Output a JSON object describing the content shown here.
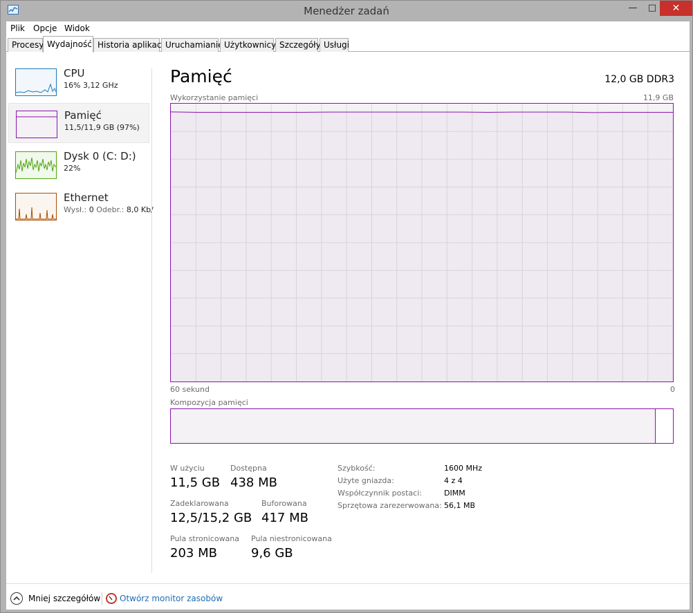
{
  "window": {
    "title": "Menedżer zadań",
    "minimize": "—",
    "maximize": "□",
    "close": "✕"
  },
  "menu": [
    "Plik",
    "Opcje",
    "Widok"
  ],
  "tabs": [
    "Procesy",
    "Wydajność",
    "Historia aplikacji",
    "Uruchamianie",
    "Użytkownicy",
    "Szczegóły",
    "Usługi"
  ],
  "active_tab": "Wydajność",
  "sidebar": {
    "items": [
      {
        "title": "CPU",
        "sub": "16%  3,12 GHz",
        "color": "#1c7bb4",
        "selected": false
      },
      {
        "title": "Pamięć",
        "sub": "11,5/11,9 GB (97%)",
        "color": "#8b12ae",
        "selected": true
      },
      {
        "title": "Dysk 0 (C: D:)",
        "sub": "22%",
        "color": "#4da60c",
        "selected": false
      },
      {
        "title": "Ethernet",
        "sub_send_label": "Wysł.:",
        "sub_send_value": "0",
        "sub_recv_label": "Odebr.:",
        "sub_recv_value": "8,0 Kb/",
        "color": "#a74f01",
        "selected": false
      }
    ]
  },
  "main": {
    "title": "Pamięć",
    "spec": "12,0 GB DDR3",
    "usage_label": "Wykorzystanie pamięci",
    "usage_max": "11,9 GB",
    "x_left": "60 sekund",
    "x_right": "0",
    "composition_label": "Kompozycja pamięci",
    "composition_inuse_fraction": 0.965,
    "accent": "#8b12ae"
  },
  "stats": {
    "in_use_label": "W użyciu",
    "in_use_value": "11,5 GB",
    "available_label": "Dostępna",
    "available_value": "438 MB",
    "committed_label": "Zadeklarowana",
    "committed_value": "12,5/15,2 GB",
    "cached_label": "Buforowana",
    "cached_value": "417 MB",
    "paged_label": "Pula stronicowana",
    "paged_value": "203 MB",
    "nonpaged_label": "Pula niestronicowana",
    "nonpaged_value": "9,6 GB"
  },
  "specs": [
    {
      "label": "Szybkość:",
      "value": "1600 MHz"
    },
    {
      "label": "Użyte gniazda:",
      "value": "4 z 4"
    },
    {
      "label": "Współczynnik postaci:",
      "value": "DIMM"
    },
    {
      "label": "Sprzętowa zarezerwowana:",
      "value": "56,1 MB"
    }
  ],
  "footer": {
    "fewer_details": "Mniej szczegółów",
    "open_monitor": "Otwórz monitor zasobów"
  },
  "chart_data": {
    "type": "line",
    "title": "Wykorzystanie pamięci",
    "xlabel": "",
    "ylabel": "",
    "x_range_label": [
      "60 sekund",
      "0"
    ],
    "ylim": [
      0,
      11.9
    ],
    "grid": true,
    "series": [
      {
        "values": [
          11.55,
          11.53,
          11.53,
          11.53,
          11.53,
          11.53,
          11.54,
          11.54,
          11.54,
          11.54,
          11.54,
          11.54,
          11.53,
          11.54,
          11.54,
          11.54,
          11.52,
          11.53,
          11.53,
          11.53
        ]
      }
    ]
  }
}
